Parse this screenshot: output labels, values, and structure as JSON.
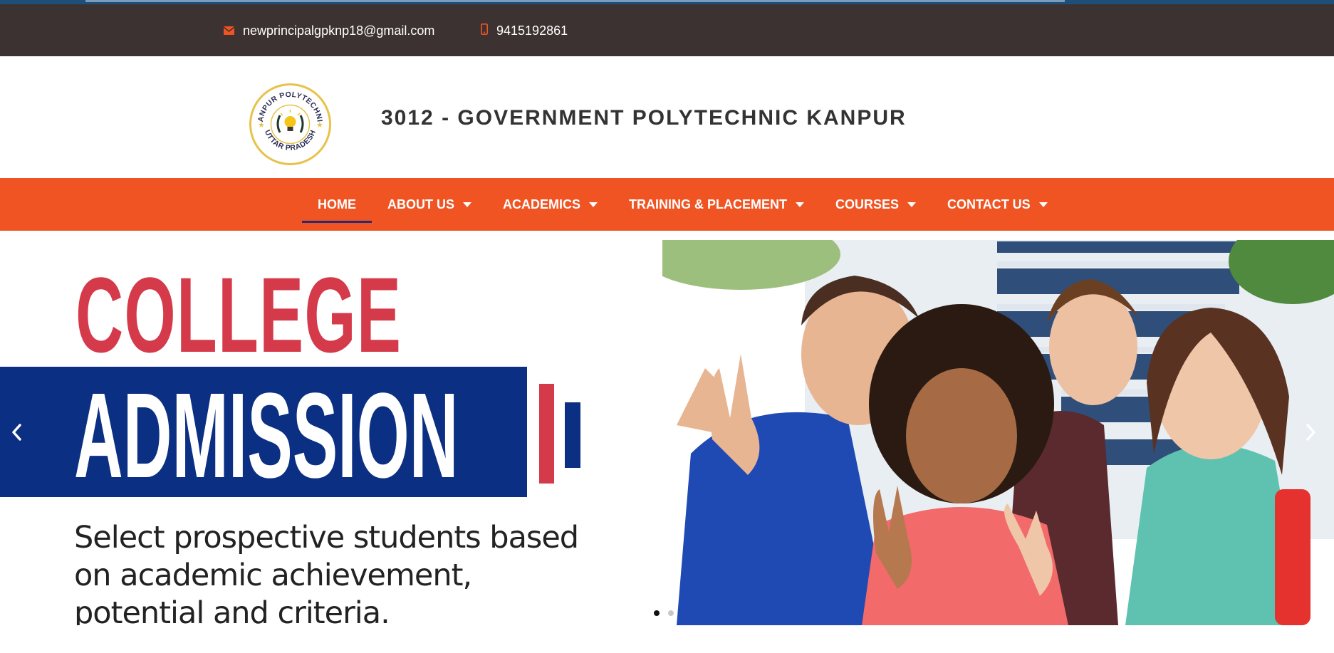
{
  "topbar": {
    "email": "newprincipalgpknp18@gmail.com",
    "phone": "9415192861",
    "email_icon": "envelope-icon",
    "phone_icon": "mobile-phone-icon"
  },
  "header": {
    "title": "3012 - GOVERNMENT POLYTECHNIC KANPUR",
    "logo": {
      "top_text": "KANPUR POLYTECHNIC",
      "bottom_text": "UTTAR PRADESH",
      "icon": "lightbulb-icon"
    }
  },
  "nav": {
    "items": [
      {
        "label": "HOME",
        "active": true,
        "dropdown": false
      },
      {
        "label": "ABOUT US",
        "active": false,
        "dropdown": true
      },
      {
        "label": "ACADEMICS",
        "active": false,
        "dropdown": true
      },
      {
        "label": "TRAINING & PLACEMENT",
        "active": false,
        "dropdown": true
      },
      {
        "label": "COURSES",
        "active": false,
        "dropdown": true
      },
      {
        "label": "CONTACT US",
        "active": false,
        "dropdown": true
      }
    ]
  },
  "slider": {
    "headline_1": "COLLEGE",
    "headline_2": "ADMISSION",
    "tagline": "Select prospective students based on academic achievement, potential and criteria.",
    "slide_count": 2,
    "active_slide": 1
  },
  "colors": {
    "topbar_bg": "#3d3232",
    "nav_bg": "#f05423",
    "accent_red": "#d43a4a",
    "accent_blue": "#0b2f82",
    "active_underline": "#2a2a72"
  }
}
